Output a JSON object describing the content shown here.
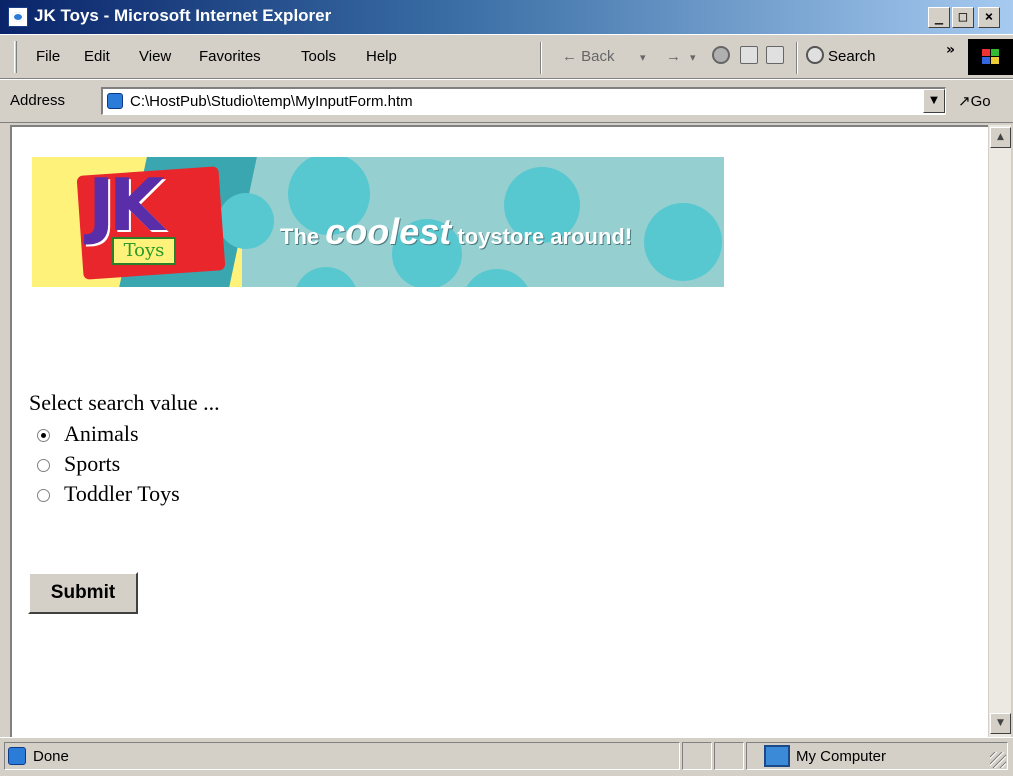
{
  "window": {
    "title": "JK Toys - Microsoft Internet Explorer",
    "controls": [
      "_",
      "□",
      "×"
    ]
  },
  "menu": {
    "items": [
      "File",
      "Edit",
      "View",
      "Favorites",
      "Tools",
      "Help"
    ]
  },
  "toolbar": {
    "back_label": "← Back",
    "search_label": "Search",
    "chevron": "»",
    "dropdown_arrows": [
      "▾",
      "▾"
    ],
    "forward_arrow": "→",
    "icons": [
      "stop-icon",
      "refresh-icon",
      "home-icon",
      "search-icon",
      "windows-logo-icon"
    ]
  },
  "address": {
    "label": "Address",
    "url": "C:\\HostPub\\Studio\\temp\\MyInputForm.htm",
    "go_label": "Go"
  },
  "banner": {
    "logo_text": "JK",
    "logo_subtext": "Toys",
    "tagline_pre": "The ",
    "tagline_emph": "coolest",
    "tagline_post": " toystore around!"
  },
  "form": {
    "prompt": "Select search value ...",
    "options": [
      {
        "label": "Animals",
        "checked": true
      },
      {
        "label": "Sports",
        "checked": false
      },
      {
        "label": "Toddler Toys",
        "checked": false
      }
    ],
    "submit_label": "Submit"
  },
  "status": {
    "text": "Done",
    "zone": "My Computer"
  },
  "colors": {
    "titlebar_start": "#0a246a",
    "titlebar_end": "#a6caf0",
    "banner_bg": "#96cfd0",
    "logo_yellow": "#fff27a",
    "logo_purple": "#5a2ea8",
    "logo_red": "#e8262b"
  }
}
